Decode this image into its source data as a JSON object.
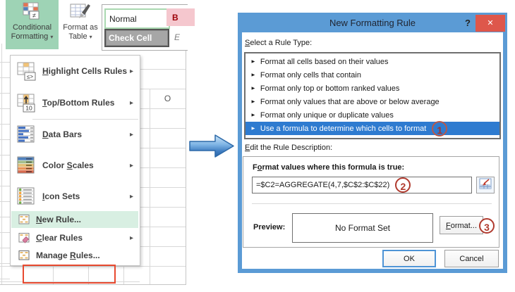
{
  "ribbon": {
    "conditional_formatting": {
      "line1": "Conditional",
      "line2": "Formatting"
    },
    "format_as_table": {
      "line1": "Format as",
      "line2": "Table"
    },
    "styles": {
      "normal": "Normal",
      "bad_partial": "B",
      "check_cell": "Check Cell",
      "explanatory_partial": "E"
    }
  },
  "spreadsheet": {
    "column_header": "O"
  },
  "menu": {
    "items": [
      {
        "label": {
          "text": "Highlight Cells Rules",
          "accel": 0
        },
        "has_submenu": true
      },
      {
        "label": {
          "text": "Top/Bottom Rules",
          "accel": 0
        },
        "has_submenu": true
      },
      {
        "label": {
          "text": "Data Bars",
          "accel": 0
        },
        "has_submenu": true
      },
      {
        "label": {
          "text": "Color Scales",
          "accel": 6
        },
        "has_submenu": true
      },
      {
        "label": {
          "text": "Icon Sets",
          "accel": 0
        },
        "has_submenu": true
      },
      {
        "label": {
          "text": "New Rule...",
          "accel": 0
        },
        "has_submenu": false,
        "highlighted": true
      },
      {
        "label": {
          "text": "Clear Rules",
          "accel": 0
        },
        "has_submenu": true
      },
      {
        "label": {
          "text": "Manage Rules...",
          "accel": 7
        },
        "has_submenu": false
      }
    ]
  },
  "dialog": {
    "title": "New Formatting Rule",
    "help_label": "?",
    "close_label": "✕",
    "select_rule_label": {
      "text": "Select a Rule Type:",
      "accel": 0
    },
    "rule_types": [
      "Format all cells based on their values",
      "Format only cells that contain",
      "Format only top or bottom ranked values",
      "Format only values that are above or below average",
      "Format only unique or duplicate values",
      "Use a formula to determine which cells to format"
    ],
    "selected_rule_index": 5,
    "edit_rule_label": {
      "text": "Edit the Rule Description:",
      "accel": 0
    },
    "formula_label": {
      "text": "Format values where this formula is true:",
      "accel": 1
    },
    "formula_value": "=$C2=AGGREGATE(4,7,$C$2:$C$22)",
    "preview_label": "Preview:",
    "preview_value": "No Format Set",
    "format_button": {
      "text": "Format...",
      "accel": 0
    },
    "ok_label": "OK",
    "cancel_label": "Cancel"
  },
  "annotations": {
    "step1": "1",
    "step2": "2",
    "step3": "3"
  },
  "icons": {
    "dropdown_caret": "▾",
    "submenu_arrow": "▸",
    "rule_bullet": "►",
    "not_equal": "≠",
    "highlight_badge": "≤>",
    "top10_badge": "10",
    "top_arrow": "↑"
  },
  "colors": {
    "accent_green": "#9ed3b5",
    "hover_green": "#d8efe2",
    "annotation_red": "#b03a2e",
    "callout_red": "#e8492f",
    "dialog_blue": "#5b9bd5",
    "selection_blue": "#2e7bd0",
    "close_red": "#de574b"
  }
}
